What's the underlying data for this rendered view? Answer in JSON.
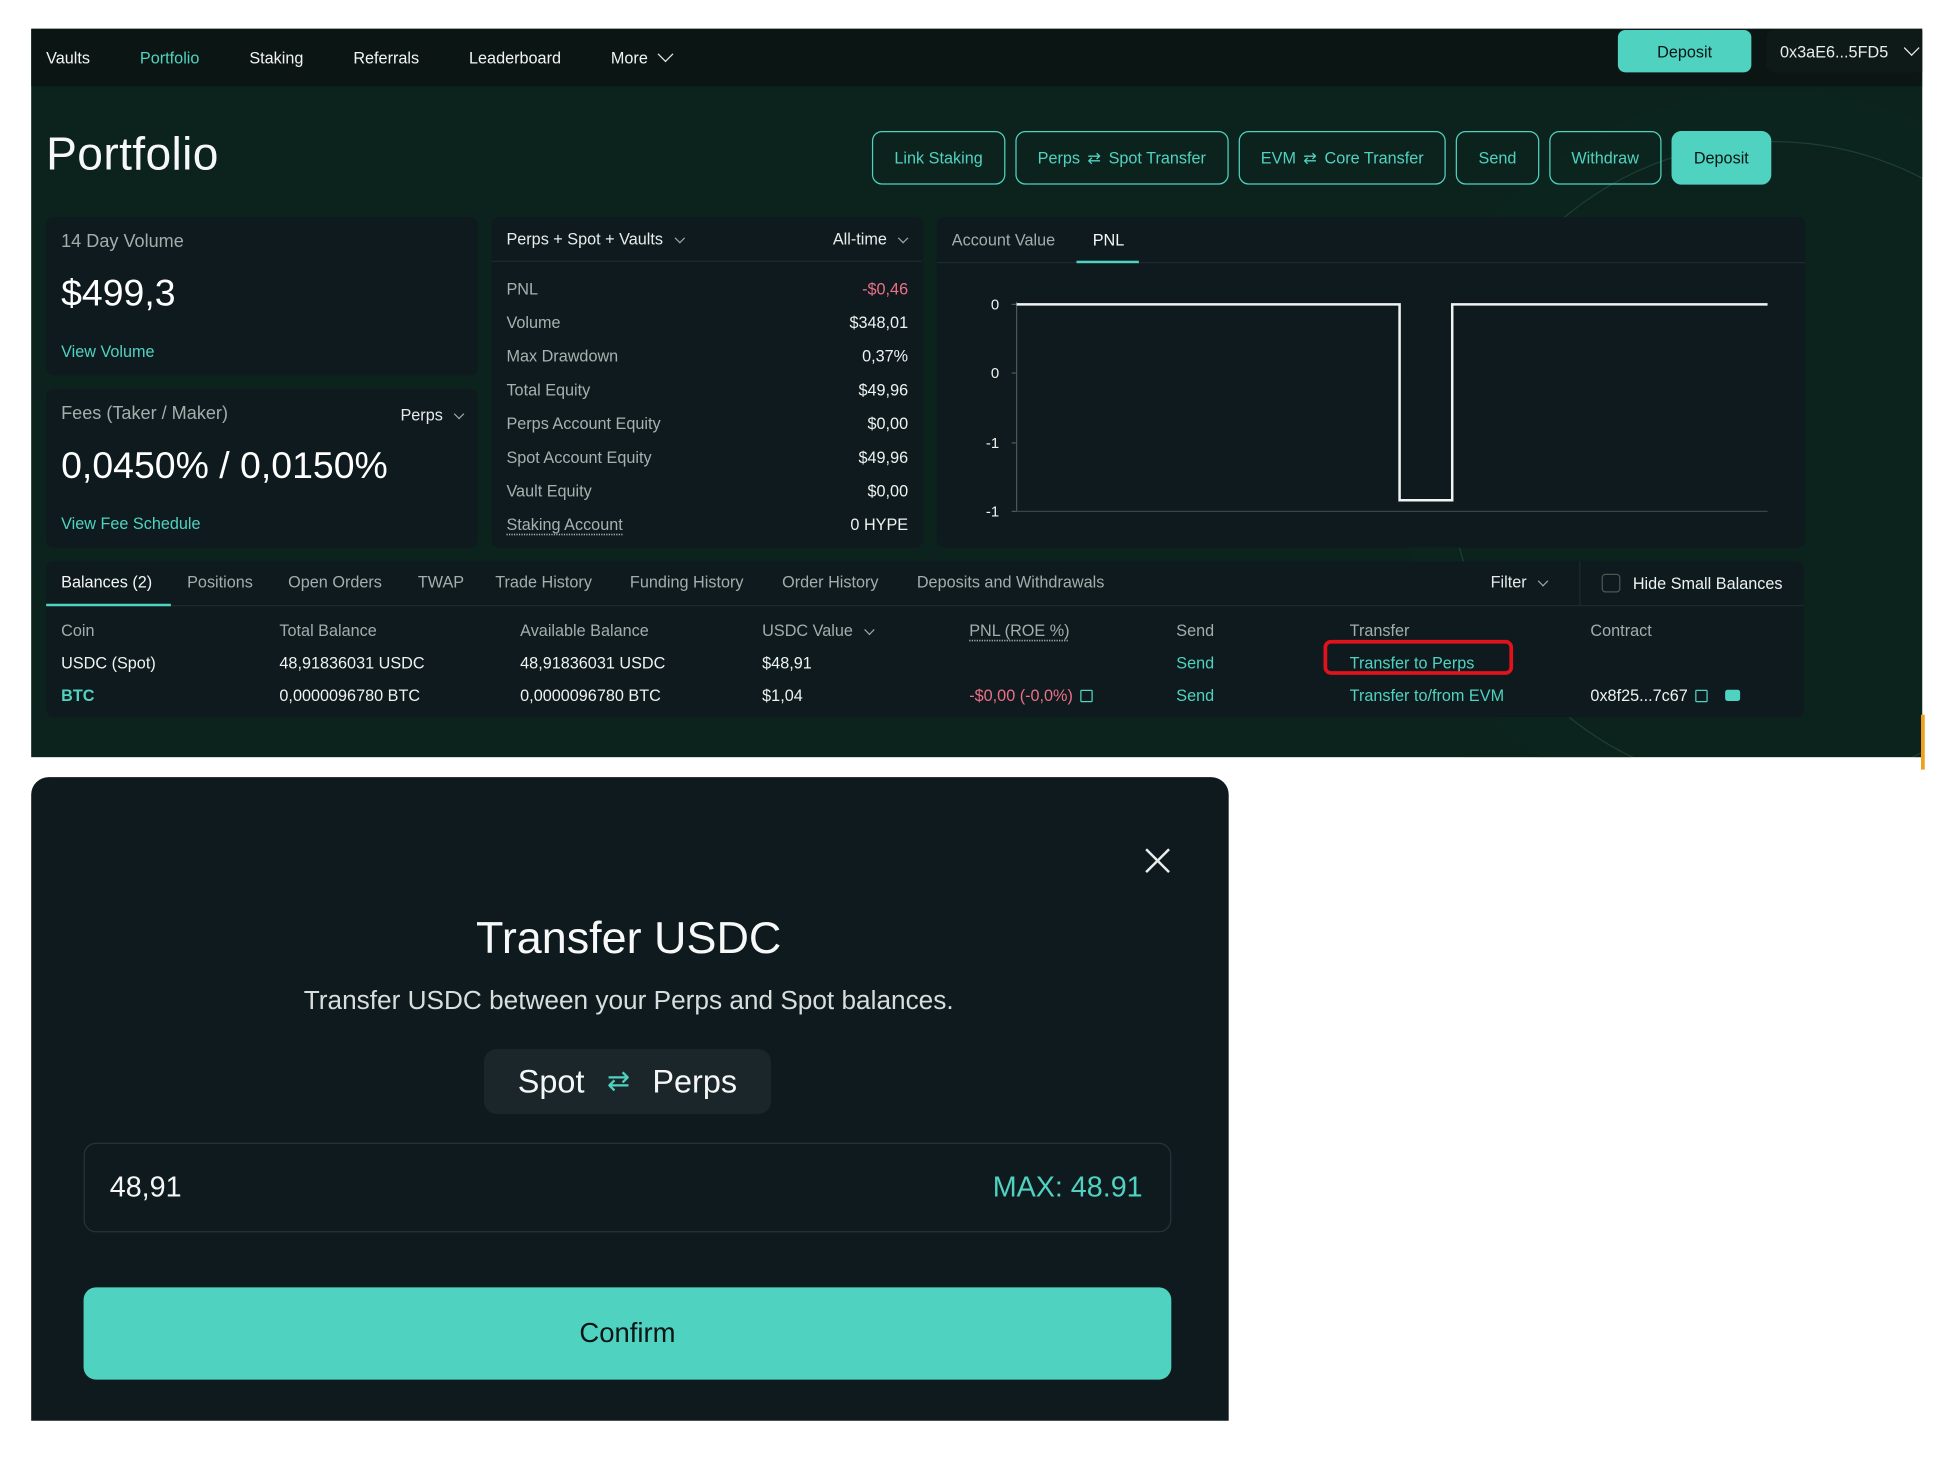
{
  "nav": {
    "items": [
      "Vaults",
      "Portfolio",
      "Staking",
      "Referrals",
      "Leaderboard",
      "More"
    ],
    "deposit_label": "Deposit",
    "address": "0x3aE6...5FD5"
  },
  "page": {
    "title": "Portfolio"
  },
  "actions": {
    "link_staking": "Link Staking",
    "perps_spot_left": "Perps",
    "perps_spot_right": "Spot Transfer",
    "evm_core_left": "EVM",
    "evm_core_right": "Core Transfer",
    "send": "Send",
    "withdraw": "Withdraw",
    "deposit": "Deposit"
  },
  "volume_card": {
    "label": "14 Day Volume",
    "value": "$499,3",
    "link": "View Volume"
  },
  "fees_card": {
    "label": "Fees (Taker / Maker)",
    "selector": "Perps",
    "value": "0,0450% / 0,0150%",
    "link": "View Fee Schedule"
  },
  "stats": {
    "scope": "Perps + Spot + Vaults",
    "period": "All-time",
    "rows": [
      {
        "k": "PNL",
        "v": "-$0,46",
        "neg": true
      },
      {
        "k": "Volume",
        "v": "$348,01"
      },
      {
        "k": "Max Drawdown",
        "v": "0,37%"
      },
      {
        "k": "Total Equity",
        "v": "$49,96"
      },
      {
        "k": "Perps Account Equity",
        "v": "$0,00"
      },
      {
        "k": "Spot Account Equity",
        "v": "$49,96"
      },
      {
        "k": "Vault Equity",
        "v": "$0,00"
      },
      {
        "k": "Staking Account",
        "v": "0 HYPE",
        "u": true
      }
    ]
  },
  "chart_tabs": {
    "account_value": "Account Value",
    "pnl": "PNL"
  },
  "chart_data": {
    "type": "line",
    "title": "",
    "xlabel": "",
    "ylabel": "",
    "y_ticks": [
      "0",
      "0",
      "-1",
      "-1"
    ],
    "series": [
      {
        "x": [
          0,
          0.51,
          0.51,
          0.58,
          0.58,
          1.0
        ],
        "y": [
          0,
          0,
          -0.46,
          -0.46,
          0,
          0
        ]
      }
    ],
    "ylim": [
      -0.46,
      0
    ]
  },
  "balances": {
    "tabs": [
      "Balances (2)",
      "Positions",
      "Open Orders",
      "TWAP",
      "Trade History",
      "Funding History",
      "Order History",
      "Deposits and Withdrawals"
    ],
    "filter": "Filter",
    "hide_small": "Hide Small Balances",
    "columns": [
      "Coin",
      "Total Balance",
      "Available Balance",
      "USDC Value",
      "PNL (ROE %)",
      "Send",
      "Transfer",
      "Contract"
    ],
    "rows": [
      {
        "coin": "USDC (Spot)",
        "total": "48,91836031 USDC",
        "available": "48,91836031 USDC",
        "usdc_value": "$48,91",
        "pnl": "",
        "send": "Send",
        "transfer": "Transfer to Perps",
        "contract": ""
      },
      {
        "coin": "BTC",
        "total": "0,0000096780 BTC",
        "available": "0,0000096780 BTC",
        "usdc_value": "$1,04",
        "pnl": "-$0,00 (-0,0%)",
        "send": "Send",
        "transfer": "Transfer to/from EVM",
        "contract": "0x8f25...7c67"
      }
    ]
  },
  "modal": {
    "title": "Transfer USDC",
    "subtitle": "Transfer USDC between your Perps and Spot balances.",
    "from": "Spot",
    "to": "Perps",
    "amount": "48,91",
    "max": "MAX: 48.91",
    "confirm": "Confirm"
  },
  "colors": {
    "accent": "#50d2c1",
    "negative": "#ed7088",
    "highlight": "#e0121b",
    "bg": "#0c221d"
  }
}
